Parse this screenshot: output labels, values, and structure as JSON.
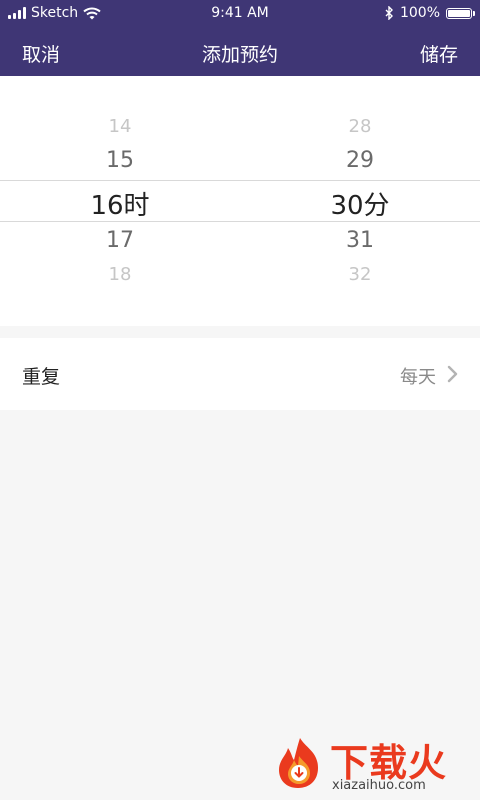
{
  "status_bar": {
    "carrier": "Sketch",
    "time": "9:41 AM",
    "battery": "100%"
  },
  "nav": {
    "cancel_label": "取消",
    "title": "添加预约",
    "save_label": "储存"
  },
  "picker": {
    "hours": [
      "14",
      "15",
      "16",
      "17",
      "18"
    ],
    "hour_unit": "时",
    "minutes": [
      "28",
      "29",
      "30",
      "31",
      "32"
    ],
    "minute_unit": "分",
    "selected_hour": "16",
    "selected_minute": "30"
  },
  "repeat": {
    "label": "重复",
    "value": "每天"
  },
  "watermark": {
    "brand": "下载火",
    "domain": "xiazaihuo.com"
  },
  "colors": {
    "header": "#3f3675",
    "background": "#f6f6f6",
    "brand_red": "#ea3a1e"
  }
}
